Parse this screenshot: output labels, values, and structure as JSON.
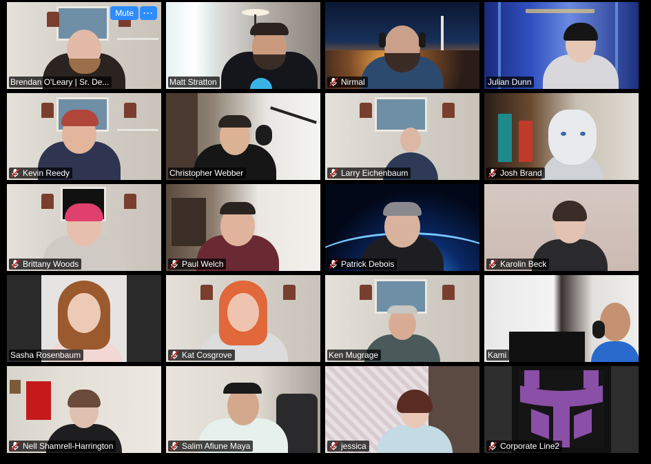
{
  "controls": {
    "mute_label": "Mute",
    "more_label": "···"
  },
  "colors": {
    "active_speaker_border": "#d9e36a",
    "mute_button": "#2d8cff",
    "muted_mic": "#e02424"
  },
  "participants": [
    {
      "name": "Brendan O'Leary | Sr. De...",
      "muted": false,
      "active": false
    },
    {
      "name": "Matt Stratton",
      "muted": false,
      "active": true
    },
    {
      "name": "Nirmal",
      "muted": true,
      "active": false
    },
    {
      "name": "Julian Dunn",
      "muted": false,
      "active": false
    },
    {
      "name": "Kevin Reedy",
      "muted": true,
      "active": false
    },
    {
      "name": "Christopher Webber",
      "muted": false,
      "active": false
    },
    {
      "name": "Larry Eichenbaum",
      "muted": true,
      "active": false
    },
    {
      "name": "Josh Brand",
      "muted": true,
      "active": false
    },
    {
      "name": "Brittany Woods",
      "muted": true,
      "active": false
    },
    {
      "name": "Paul Welch",
      "muted": true,
      "active": false
    },
    {
      "name": "Patrick Debois",
      "muted": true,
      "active": false
    },
    {
      "name": "Karolin Beck",
      "muted": true,
      "active": false
    },
    {
      "name": "Sasha Rosenbaum",
      "muted": false,
      "active": false
    },
    {
      "name": "Kat Cosgrove",
      "muted": true,
      "active": false
    },
    {
      "name": "Ken Mugrage",
      "muted": false,
      "active": false
    },
    {
      "name": "Kami",
      "muted": false,
      "active": false
    },
    {
      "name": "Nell Shamrell-Harrington",
      "muted": true,
      "active": false
    },
    {
      "name": "Salim Afiune Maya",
      "muted": true,
      "active": false
    },
    {
      "name": "jessica",
      "muted": true,
      "active": false
    },
    {
      "name": "Corporate Line2",
      "muted": true,
      "active": false
    }
  ]
}
